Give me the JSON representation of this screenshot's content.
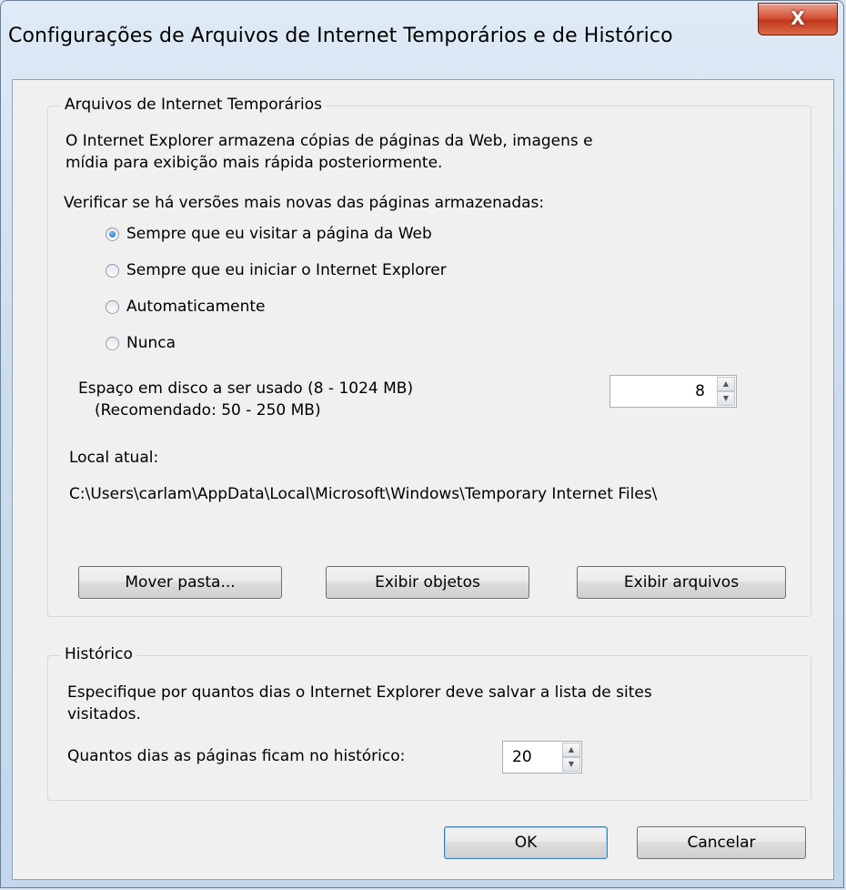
{
  "window": {
    "title": "Configurações de Arquivos de Internet Temporários e de Histórico",
    "close_icon": "close-icon",
    "close_glyph": "X"
  },
  "temp_files": {
    "group_label": "Arquivos de Internet Temporários",
    "description_line1": "O Internet Explorer armazena cópias de páginas da Web, imagens e",
    "description_line2": "mídia para exibição mais rápida posteriormente.",
    "check_label": "Verificar se há versões mais novas das páginas armazenadas:",
    "options": [
      {
        "label": "Sempre que eu visitar a página da Web",
        "checked": true
      },
      {
        "label": "Sempre que eu iniciar o Internet Explorer",
        "checked": false
      },
      {
        "label": "Automaticamente",
        "checked": false
      },
      {
        "label": "Nunca",
        "checked": false
      }
    ],
    "disk_space_label": "Espaço em disco a ser usado (8 - 1024 MB)",
    "disk_space_recommended": "(Recomendado: 50 - 250 MB)",
    "disk_space_value": "8",
    "current_location_label": "Local atual:",
    "current_location_path": "C:\\Users\\carlam\\AppData\\Local\\Microsoft\\Windows\\Temporary Internet Files\\",
    "buttons": {
      "move_folder": "Mover pasta...",
      "view_objects": "Exibir objetos",
      "view_files": "Exibir arquivos"
    }
  },
  "history": {
    "group_label": "Histórico",
    "description_line1": "Especifique por quantos dias o Internet Explorer deve salvar a lista de sites",
    "description_line2": "visitados.",
    "days_label": "Quantos dias as páginas ficam no histórico:",
    "days_value": "20"
  },
  "footer": {
    "ok": "OK",
    "cancel": "Cancelar"
  },
  "colors": {
    "title_bar": "#cbdcee",
    "close_button": "#c23a1f",
    "dialog_background": "#f0f0f0",
    "radio_selected": "#1a5fb8"
  }
}
